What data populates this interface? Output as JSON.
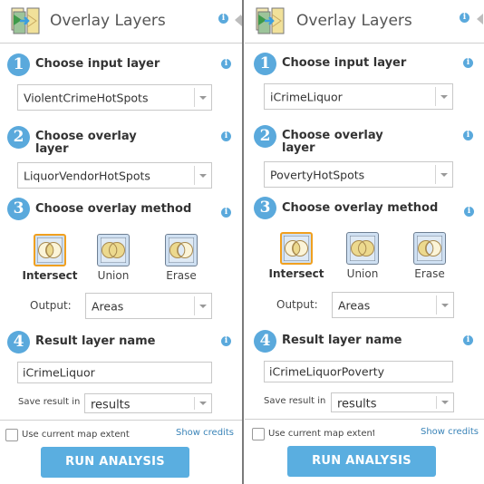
{
  "colors": {
    "accent": "#5aa9dc",
    "run_button": "#5aaee0",
    "selected_border": "#f0a020",
    "link": "#3a84b8"
  },
  "panels": [
    {
      "header": {
        "title": "Overlay Layers",
        "icon": "overlay-layers-icon",
        "info_icon": "info-icon"
      },
      "steps": {
        "input": {
          "number": "1",
          "label": "Choose input layer",
          "value": "ViolentCrimeHotSpots"
        },
        "overlay": {
          "number": "2",
          "label_line1": "Choose overlay",
          "label_line2": "layer",
          "value": "LiquorVendorHotSpots"
        },
        "method": {
          "number": "3",
          "label": "Choose overlay method",
          "options": [
            {
              "label": "Intersect",
              "selected": true
            },
            {
              "label": "Union",
              "selected": false
            },
            {
              "label": "Erase",
              "selected": false
            }
          ],
          "output_label": "Output:",
          "output_value": "Areas"
        },
        "result": {
          "number": "4",
          "label": "Result layer name",
          "value": "iCrimeLiquor",
          "save_label": "Save result in",
          "save_value": "results"
        }
      },
      "footer": {
        "checkbox_label": "Use current map extent",
        "checkbox_checked": false,
        "credits_link": "Show credits",
        "run_label": "RUN ANALYSIS"
      }
    },
    {
      "header": {
        "title": "Overlay Layers",
        "icon": "overlay-layers-icon",
        "info_icon": "info-icon"
      },
      "steps": {
        "input": {
          "number": "1",
          "label": "Choose input layer",
          "value": "iCrimeLiquor"
        },
        "overlay": {
          "number": "2",
          "label_line1": "Choose overlay",
          "label_line2": "layer",
          "value": "PovertyHotSpots"
        },
        "method": {
          "number": "3",
          "label": "Choose overlay method",
          "options": [
            {
              "label": "Intersect",
              "selected": true
            },
            {
              "label": "Union",
              "selected": false
            },
            {
              "label": "Erase",
              "selected": false
            }
          ],
          "output_label": "Output:",
          "output_value": "Areas"
        },
        "result": {
          "number": "4",
          "label": "Result layer name",
          "value": "iCrimeLiquorPoverty",
          "save_label": "Save result in",
          "save_value": "results"
        }
      },
      "footer": {
        "checkbox_label": "Use current map extent",
        "checkbox_checked": false,
        "credits_link": "Show credits",
        "run_label": "RUN ANALYSIS"
      }
    }
  ]
}
